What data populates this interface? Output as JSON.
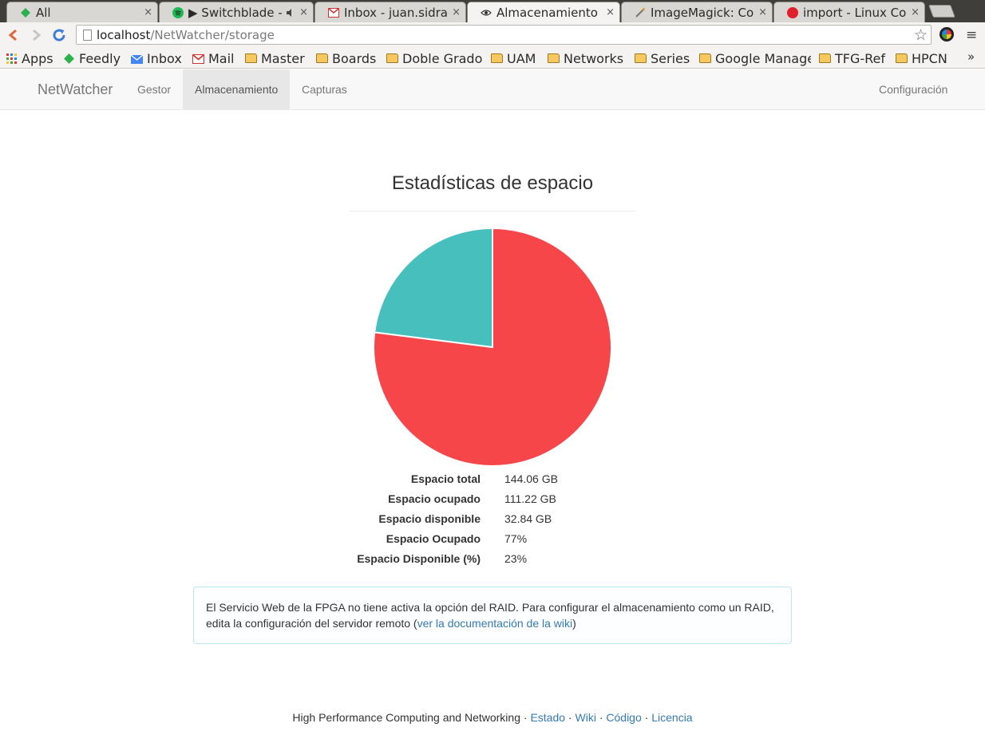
{
  "browser": {
    "tabs": [
      {
        "title": "All",
        "icon": "feedly-icon",
        "active": false
      },
      {
        "title": "▶ Switchblade - ",
        "icon": "spotify-icon",
        "active": false
      },
      {
        "title": "Inbox - juan.sidrac",
        "icon": "gmail-icon",
        "active": false
      },
      {
        "title": "Almacenamiento",
        "icon": "eye-icon",
        "active": true
      },
      {
        "title": "ImageMagick: Co",
        "icon": "wand-icon",
        "active": false
      },
      {
        "title": "import - Linux Co",
        "icon": "record-icon",
        "active": false
      }
    ],
    "tab_close": "×",
    "url_host": "localhost",
    "url_path": "/NetWatcher/storage",
    "bookmarks": [
      {
        "label": "Apps",
        "icon": "apps-grid-icon"
      },
      {
        "label": "Feedly",
        "icon": "feedly-icon"
      },
      {
        "label": "Inbox",
        "icon": "inbox-icon"
      },
      {
        "label": "Mail",
        "icon": "gmail-icon"
      },
      {
        "label": "Master",
        "icon": "folder-icon"
      },
      {
        "label": "Boards",
        "icon": "folder-icon"
      },
      {
        "label": "Doble Grado",
        "icon": "folder-icon"
      },
      {
        "label": "UAM",
        "icon": "folder-icon"
      },
      {
        "label": "Networks",
        "icon": "folder-icon"
      },
      {
        "label": "Series",
        "icon": "folder-icon"
      },
      {
        "label": "Google Manage",
        "icon": "folder-icon"
      },
      {
        "label": "TFG-Ref",
        "icon": "folder-icon"
      },
      {
        "label": "HPCN",
        "icon": "folder-icon"
      }
    ],
    "bookmarks_more": "»"
  },
  "navbar": {
    "brand": "NetWatcher",
    "links": [
      "Gestor",
      "Almacenamiento",
      "Capturas"
    ],
    "active_link": "Almacenamiento",
    "right_link": "Configuración"
  },
  "stats": {
    "title": "Estadísticas de espacio",
    "rows": [
      {
        "label": "Espacio total",
        "value": "144.06 GB"
      },
      {
        "label": "Espacio ocupado",
        "value": "111.22 GB"
      },
      {
        "label": "Espacio disponible",
        "value": "32.84 GB"
      },
      {
        "label": "Espacio Ocupado",
        "value": "77%"
      },
      {
        "label": "Espacio Disponible (%)",
        "value": "23%"
      }
    ]
  },
  "chart_data": {
    "type": "pie",
    "categories": [
      "Espacio ocupado",
      "Espacio disponible"
    ],
    "values": [
      77,
      23
    ],
    "colors": [
      "#f7464a",
      "#46bfbd"
    ]
  },
  "alert": {
    "text": "El Servicio Web de la FPGA no tiene activa la opción del RAID. Para configurar el almacenamiento como un RAID, edita la configuración del servidor remoto (",
    "link": "ver la documentación de la wiki",
    "text_end": ")"
  },
  "footer": {
    "text": "High Performance Computing and Networking",
    "sep": " · ",
    "links": [
      "Estado",
      "Wiki",
      "Código",
      "Licencia"
    ]
  }
}
